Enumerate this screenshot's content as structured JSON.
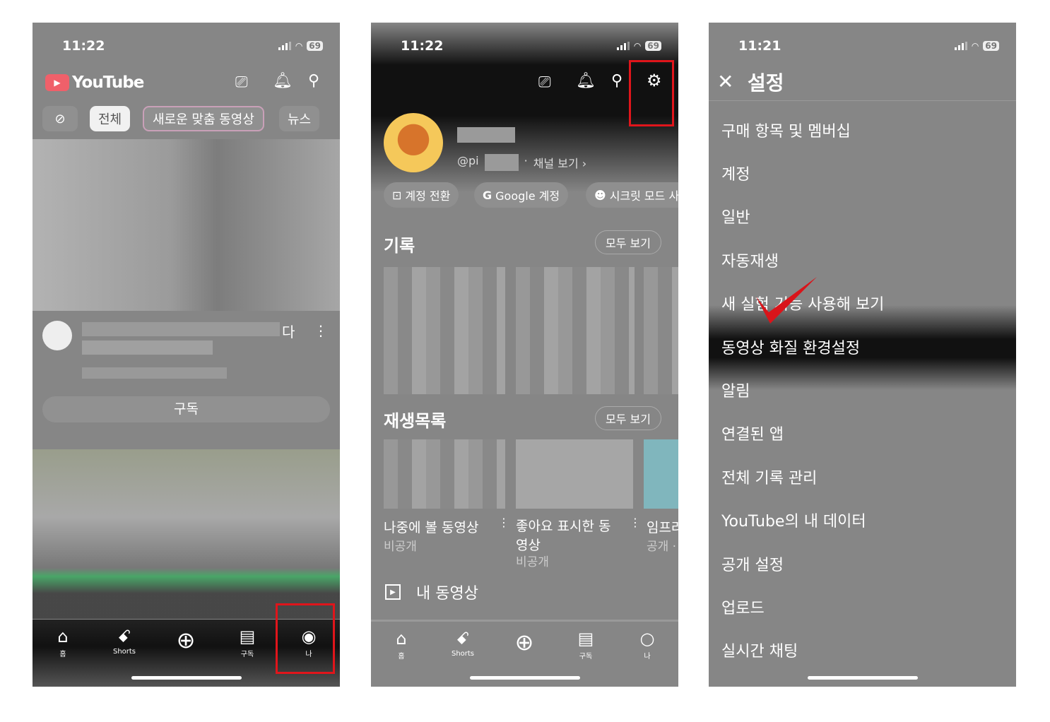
{
  "panel1": {
    "time": "11:22",
    "battery": "69",
    "logo": "YouTube",
    "chips": [
      "전체",
      "새로운 맞춤 동영상",
      "뉴스"
    ],
    "video_title_tail": "다",
    "subscribe": "구독",
    "nav": [
      {
        "label": "홈",
        "icon": "home-icon"
      },
      {
        "label": "Shorts",
        "icon": "shorts-icon"
      },
      {
        "label": "",
        "icon": "create-icon"
      },
      {
        "label": "구독",
        "icon": "subscriptions-icon"
      },
      {
        "label": "나",
        "icon": "you-icon"
      }
    ]
  },
  "panel2": {
    "time": "11:22",
    "battery": "69",
    "handle": "@pi",
    "view_channel": "채널 보기 ›",
    "chips": [
      "계정 전환",
      "Google 계정",
      "시크릿 모드 사"
    ],
    "history": {
      "title": "기록",
      "view_all": "모두 보기"
    },
    "playlists": {
      "title": "재생목록",
      "view_all": "모두 보기",
      "items": [
        {
          "title": "나중에 볼 동영상",
          "sub": "비공개"
        },
        {
          "title": "좋아요 표시한 동영상",
          "sub": "비공개"
        },
        {
          "title": "임프라",
          "sub": "공개 ·"
        }
      ]
    },
    "my_videos": "내 동영상",
    "nav": [
      {
        "label": "홈"
      },
      {
        "label": "Shorts"
      },
      {
        "label": ""
      },
      {
        "label": "구독"
      },
      {
        "label": "나"
      }
    ]
  },
  "panel3": {
    "time": "11:21",
    "battery": "69",
    "title": "설정",
    "items": [
      "구매 항목 및 멤버십",
      "계정",
      "일반",
      "자동재생",
      "새 실험 기능 사용해 보기",
      "동영상 화질 환경설정",
      "알림",
      "연결된 앱",
      "전체 기록 관리",
      "YouTube의 내 데이터",
      "공개 설정",
      "업로드",
      "실시간 채팅"
    ],
    "highlighted": "동영상 화질 환경설정"
  },
  "colors": {
    "annotation": "#e0151b",
    "youtube_red": "#f0606a",
    "background": "#868686"
  }
}
